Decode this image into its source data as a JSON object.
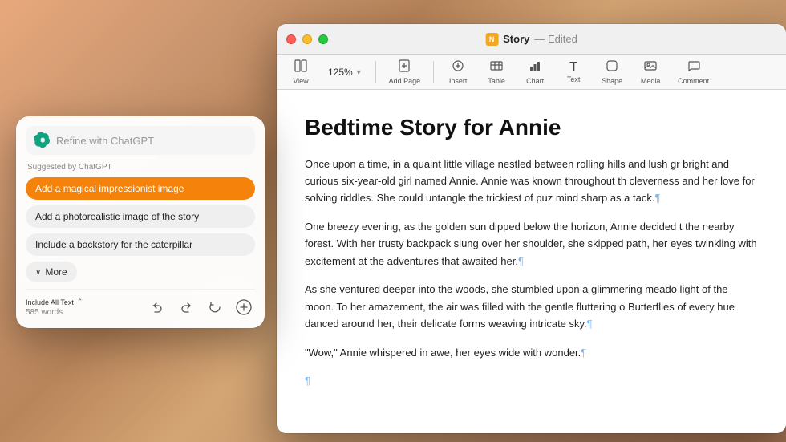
{
  "window": {
    "title": "Story",
    "subtitle": "Edited",
    "traffic_lights": [
      "close",
      "minimize",
      "maximize"
    ]
  },
  "toolbar": {
    "zoom_label": "125%",
    "items": [
      {
        "label": "View",
        "icon": "⊞"
      },
      {
        "label": "Zoom",
        "icon": "125%"
      },
      {
        "label": "Add Page",
        "icon": "+"
      },
      {
        "label": "Insert",
        "icon": "⊕"
      },
      {
        "label": "Table",
        "icon": "⊞"
      },
      {
        "label": "Chart",
        "icon": "📊"
      },
      {
        "label": "Text",
        "icon": "T"
      },
      {
        "label": "Shape",
        "icon": "○"
      },
      {
        "label": "Media",
        "icon": "🖼"
      },
      {
        "label": "Comment",
        "icon": "💬"
      }
    ]
  },
  "document": {
    "title": "Bedtime Story for Annie",
    "paragraphs": [
      "Once upon a time, in a quaint little village nestled between rolling hills and lush gr bright and curious six-year-old girl named Annie. Annie was known throughout th cleverness and her love for solving riddles. She could untangle the trickiest of puz mind sharp as a tack.¶",
      "One breezy evening, as the golden sun dipped below the horizon, Annie decided t the nearby forest. With her trusty backpack slung over her shoulder, she skipped path, her eyes twinkling with excitement at the adventures that awaited her.¶",
      "As she ventured deeper into the woods, she stumbled upon a glimmering meado light of the moon. To her amazement, the air was filled with the gentle fluttering o Butterflies of every hue danced around her, their delicate forms weaving intricate sky.¶",
      "\"Wow,\" Annie whispered in awe, her eyes wide with wonder.¶",
      "¶"
    ]
  },
  "chatgpt_panel": {
    "input_placeholder": "Refine with ChatGPT",
    "suggested_label": "Suggested by ChatGPT",
    "suggestions": [
      {
        "text": "Add a magical impressionist image",
        "active": true
      },
      {
        "text": "Add a photorealistic image of the story",
        "active": false
      },
      {
        "text": "Include a backstory for the caterpillar",
        "active": false
      }
    ],
    "more_button": "More",
    "footer": {
      "include_text": "Include All Text",
      "word_count": "585 words",
      "actions": [
        "undo",
        "redo",
        "refresh",
        "add"
      ]
    }
  },
  "colors": {
    "accent": "#f5820a",
    "suggestion_active_bg": "#f5820a",
    "suggestion_inactive_bg": "#efefef",
    "pilcrow": "#74b9ff"
  }
}
